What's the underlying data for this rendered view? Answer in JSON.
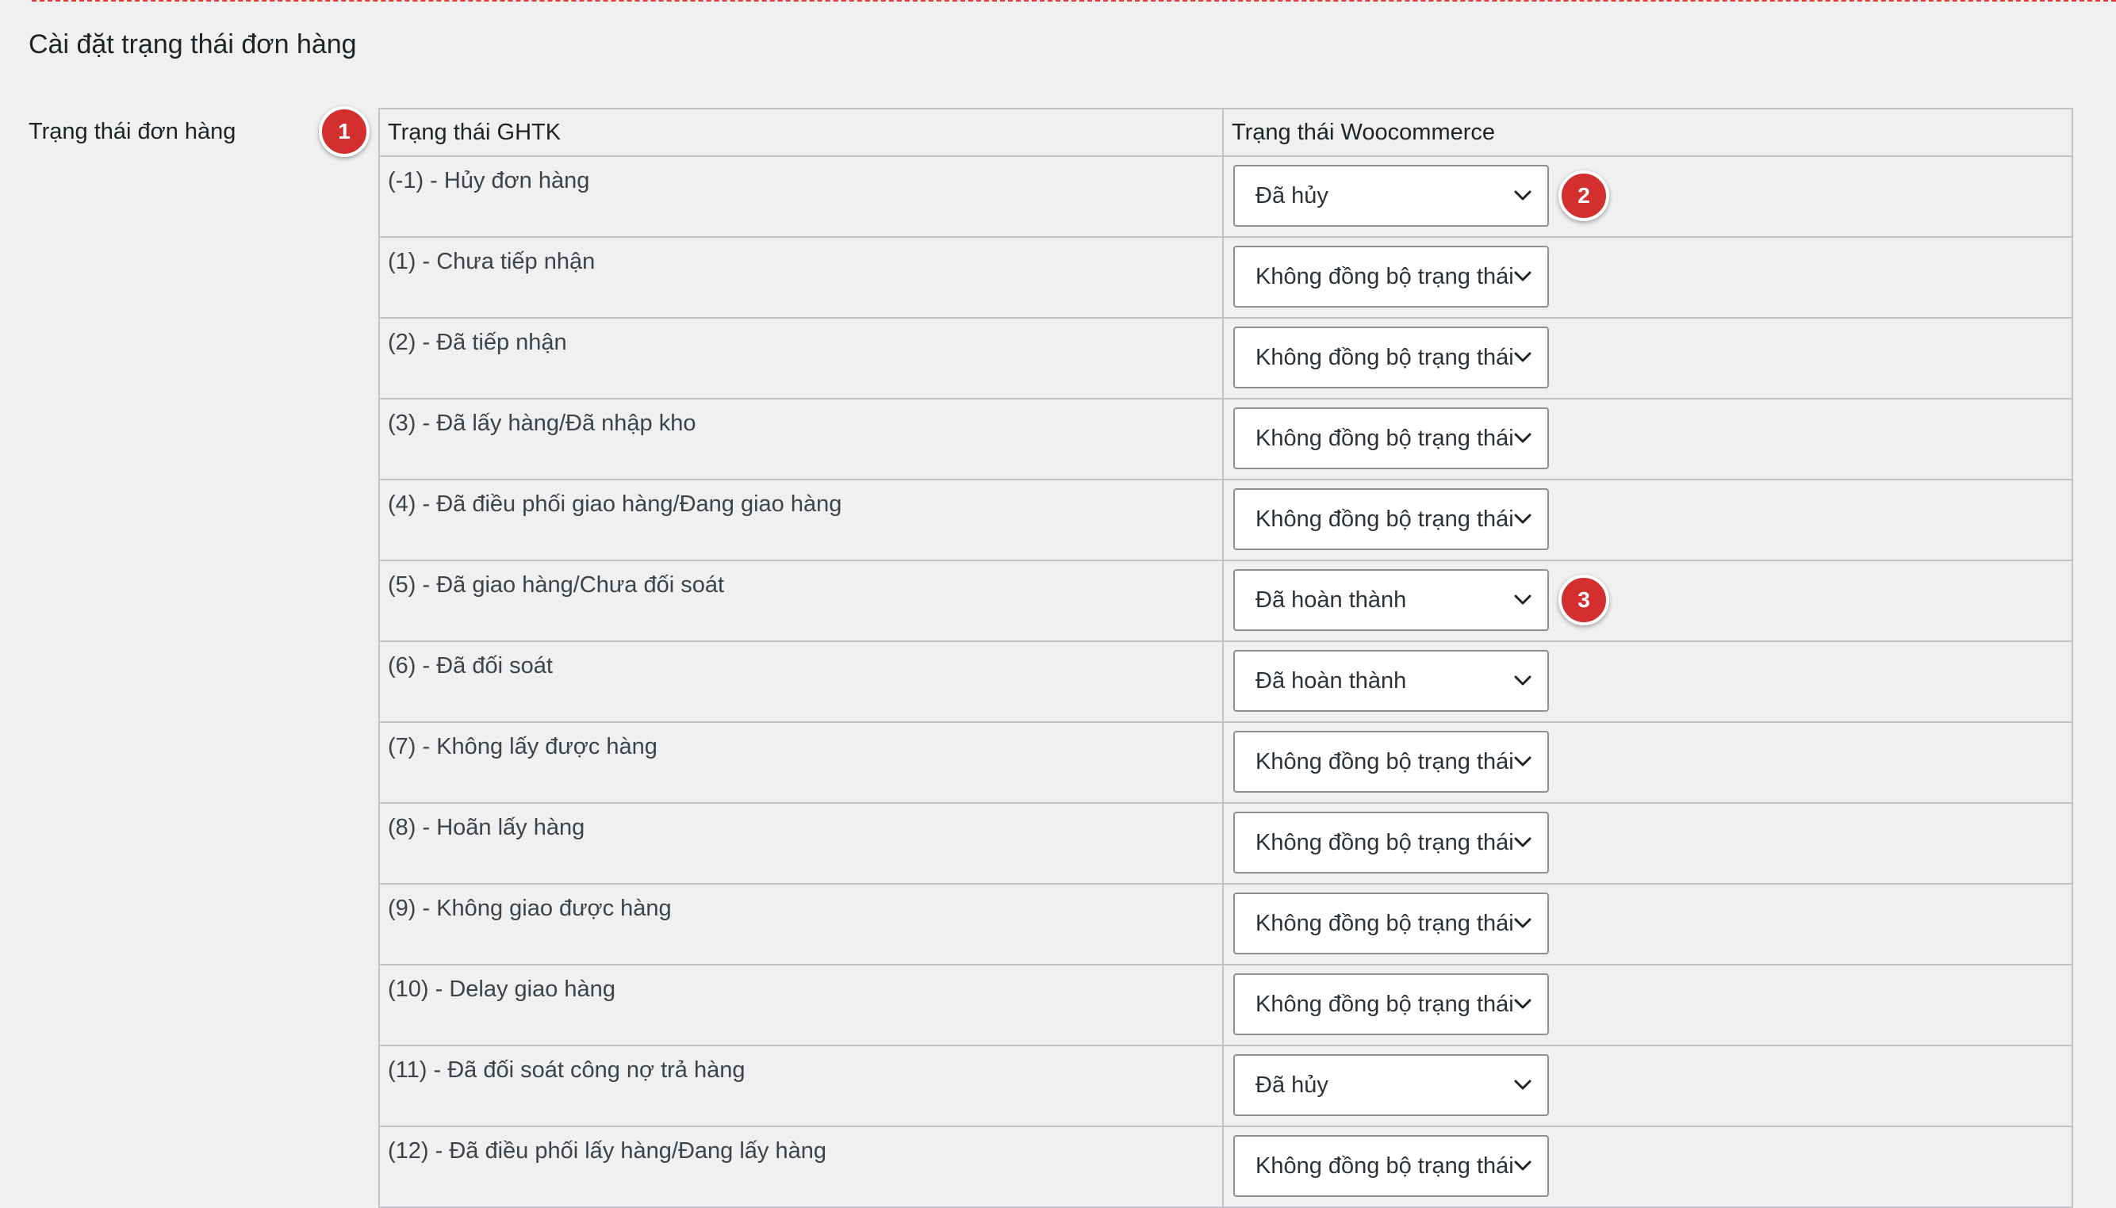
{
  "section": {
    "title": "Cài đặt trạng thái đơn hàng"
  },
  "field": {
    "label": "Trạng thái đơn hàng"
  },
  "table": {
    "headers": {
      "ghtk": "Trạng thái GHTK",
      "woocommerce": "Trạng thái Woocommerce"
    },
    "rows": [
      {
        "ghtk": "(-1) - Hủy đơn hàng",
        "woo": "Đã hủy"
      },
      {
        "ghtk": "(1) - Chưa tiếp nhận",
        "woo": "Không đồng bộ trạng thái"
      },
      {
        "ghtk": "(2) - Đã tiếp nhận",
        "woo": "Không đồng bộ trạng thái"
      },
      {
        "ghtk": "(3) - Đã lấy hàng/Đã nhập kho",
        "woo": "Không đồng bộ trạng thái"
      },
      {
        "ghtk": "(4) - Đã điều phối giao hàng/Đang giao hàng",
        "woo": "Không đồng bộ trạng thái"
      },
      {
        "ghtk": "(5) - Đã giao hàng/Chưa đối soát",
        "woo": "Đã hoàn thành"
      },
      {
        "ghtk": "(6) - Đã đối soát",
        "woo": "Đã hoàn thành"
      },
      {
        "ghtk": "(7) - Không lấy được hàng",
        "woo": "Không đồng bộ trạng thái"
      },
      {
        "ghtk": "(8) - Hoãn lấy hàng",
        "woo": "Không đồng bộ trạng thái"
      },
      {
        "ghtk": "(9) - Không giao được hàng",
        "woo": "Không đồng bộ trạng thái"
      },
      {
        "ghtk": "(10) - Delay giao hàng",
        "woo": "Không đồng bộ trạng thái"
      },
      {
        "ghtk": "(11) - Đã đối soát công nợ trả hàng",
        "woo": "Đã hủy"
      },
      {
        "ghtk": "(12) - Đã điều phối lấy hàng/Đang lấy hàng",
        "woo": "Không đồng bộ trạng thái"
      }
    ]
  },
  "annotations": {
    "badge_1": "1",
    "badge_2": "2",
    "badge_3": "3"
  },
  "colors": {
    "badge": "#d32f2f",
    "page_background": "#f0f0f0",
    "table_border": "#c3c4c7",
    "top_dashed_border": "#e53935"
  },
  "icons": {
    "select": "chevron-down-icon"
  }
}
